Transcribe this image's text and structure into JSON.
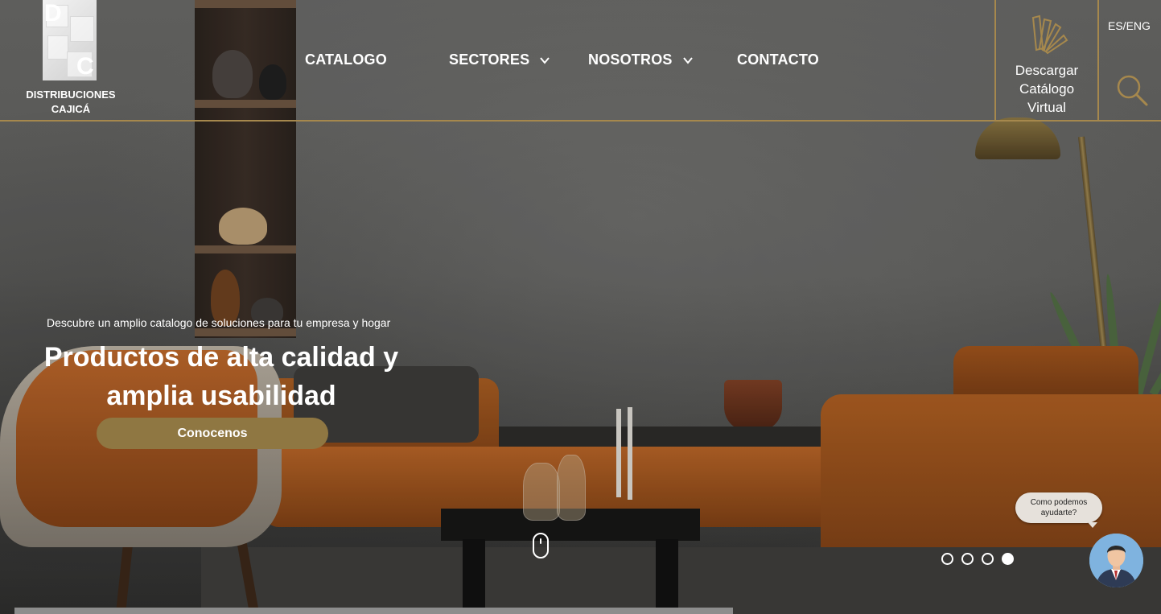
{
  "brand": {
    "logo_letters": [
      "D",
      "C"
    ],
    "name_line1": "DISTRIBUCIONES",
    "name_line2": "CAJICÁ"
  },
  "nav": {
    "items": [
      {
        "label": "CATALOGO",
        "has_dropdown": false
      },
      {
        "label": "SECTORES",
        "has_dropdown": true
      },
      {
        "label": "NOSOTROS",
        "has_dropdown": true
      },
      {
        "label": "CONTACTO",
        "has_dropdown": false
      }
    ]
  },
  "download": {
    "line1": "Descargar",
    "line2": "Catálogo",
    "line3": "Virtual",
    "icon": "catalog-swatch-icon"
  },
  "lang": "ES/ENG",
  "search_icon": "search-icon",
  "hero": {
    "subtitle": "Descubre un amplio catalogo de soluciones para tu empresa y hogar",
    "title_line1": "Productos de alta calidad y",
    "title_line2": "amplia usabilidad",
    "cta_label": "Conocenos"
  },
  "carousel": {
    "slide_count": 4,
    "active_index": 3
  },
  "chat": {
    "line1": "Como podemos",
    "line2": "ayudarte?"
  },
  "colors": {
    "accent": "#a6884d",
    "cta": "#8f7742"
  }
}
